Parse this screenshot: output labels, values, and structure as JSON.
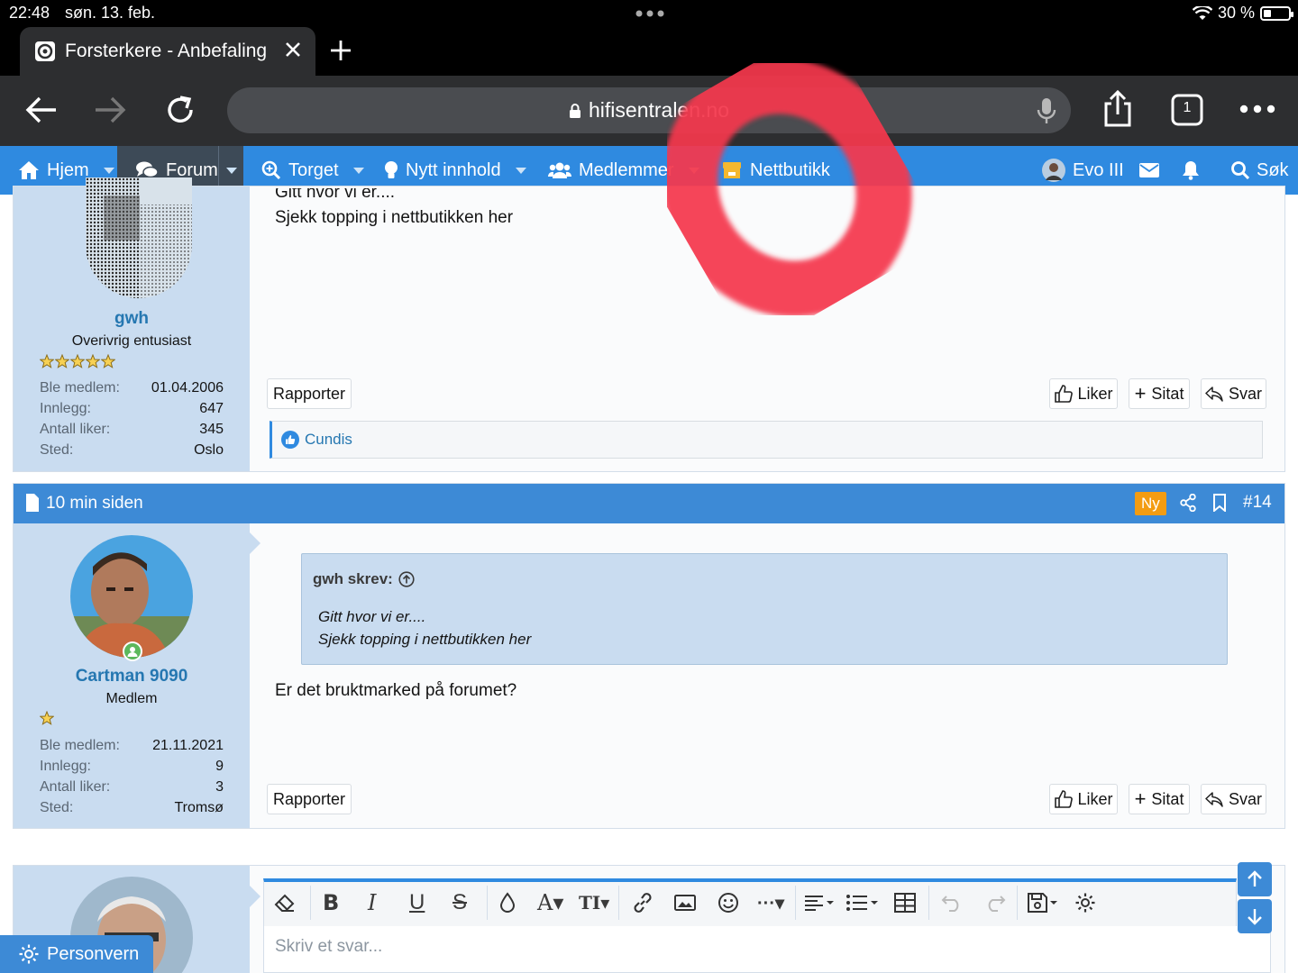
{
  "status_bar": {
    "time": "22:48",
    "date": "søn. 13. feb.",
    "battery": "30 %",
    "battery_level": 0.3
  },
  "browser": {
    "tab_title": "Forsterkere - Anbefaling",
    "url": "hifisentralen.no",
    "tab_count": "1"
  },
  "nav": {
    "home": "Hjem",
    "forum": "Forum",
    "market": "Torget",
    "new_content": "Nytt innhold",
    "members": "Medlemmer",
    "shop": "Nettbutikk",
    "user": "Evo III",
    "search": "Søk"
  },
  "post1": {
    "partial_text": "Gitt hvor vi er....",
    "text": "Sjekk topping i nettbutikken her",
    "username": "gwh",
    "user_title": "Overivrig entusiast",
    "stars": 5,
    "stats": [
      {
        "label": "Ble medlem:",
        "value": "01.04.2006"
      },
      {
        "label": "Innlegg:",
        "value": "647"
      },
      {
        "label": "Antall liker:",
        "value": "345"
      },
      {
        "label": "Sted:",
        "value": "Oslo"
      }
    ],
    "report": "Rapporter",
    "like": "Liker",
    "quote": "Sitat",
    "reply": "Svar",
    "liked_by": "Cundis"
  },
  "post2": {
    "time": "10 min siden",
    "new_badge": "Ny",
    "number": "#14",
    "quote_author": "gwh skrev:",
    "quote_line1": "Gitt hvor vi er....",
    "quote_line2": "Sjekk topping i nettbutikken her",
    "text": "Er det bruktmarked på forumet?",
    "username": "Cartman 9090",
    "user_title": "Medlem",
    "stars": 1,
    "stats": [
      {
        "label": "Ble medlem:",
        "value": "21.11.2021"
      },
      {
        "label": "Innlegg:",
        "value": "9"
      },
      {
        "label": "Antall liker:",
        "value": "3"
      },
      {
        "label": "Sted:",
        "value": "Tromsø"
      }
    ],
    "report": "Rapporter",
    "like": "Liker",
    "quote": "Sitat",
    "reply": "Svar"
  },
  "editor": {
    "placeholder": "Skriv et svar..."
  },
  "privacy": "Personvern",
  "colors": {
    "accent": "#2f8ae0",
    "sidebar": "#c9dcf0",
    "username": "#2577b1",
    "new_badge": "#f39c12",
    "annotation": "#f5384e"
  }
}
